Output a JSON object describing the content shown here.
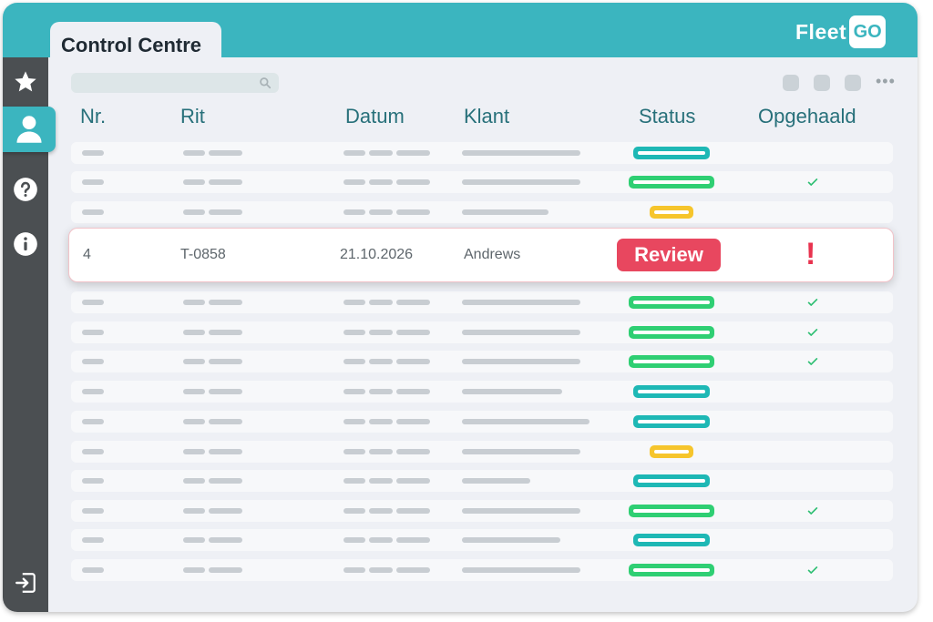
{
  "app": {
    "title": "Control Centre",
    "brand_text": "Fleet",
    "brand_mark": "GO"
  },
  "sidebar": {
    "icons": [
      "star-icon",
      "user-icon",
      "help-icon",
      "info-icon",
      "logout-icon"
    ],
    "active": "user-icon"
  },
  "search": {
    "icon": "search-icon"
  },
  "table": {
    "headers": {
      "nr": "Nr.",
      "rit": "Rit",
      "datum": "Datum",
      "klant": "Klant",
      "status": "Status",
      "opgehaald": "Opgehaald"
    },
    "highlighted_row": {
      "nr": "4",
      "rit": "T-0858",
      "datum": "21.10.2026",
      "klant": "Andrews",
      "status": "Review",
      "opgehaald_icon": "alert-icon"
    },
    "rows": [
      {
        "status": "teal",
        "picked_up": false
      },
      {
        "status": "green",
        "picked_up": true
      },
      {
        "status": "yellow",
        "picked_up": false
      },
      {
        "status": "green",
        "picked_up": true
      },
      {
        "status": "green",
        "picked_up": true
      },
      {
        "status": "green",
        "picked_up": true
      },
      {
        "status": "teal",
        "picked_up": false
      },
      {
        "status": "teal",
        "picked_up": false
      },
      {
        "status": "yellow",
        "picked_up": false
      },
      {
        "status": "teal",
        "picked_up": false
      },
      {
        "status": "green",
        "picked_up": true
      },
      {
        "status": "teal",
        "picked_up": false
      },
      {
        "status": "green",
        "picked_up": true
      }
    ]
  },
  "colors": {
    "accent": "#3bb5bf",
    "sidebar": "#4b4f52",
    "review": "#e8475f",
    "teal": "#1eb8b5",
    "green": "#2fcf73",
    "yellow": "#f6c52c",
    "check": "#2fbf73"
  }
}
